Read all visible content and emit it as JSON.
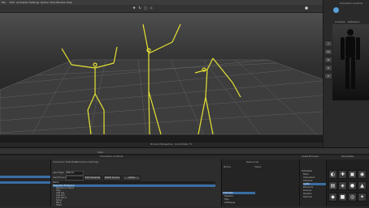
{
  "menubar": {
    "items": [
      "File",
      "Edit",
      "Animation",
      "Settings",
      "Python Tools",
      "Window",
      "Help"
    ]
  },
  "toolbar": {
    "icons": [
      "move-icon",
      "rotate-icon",
      "scale-icon",
      "select-icon",
      "camera-icon"
    ]
  },
  "viewport": {
    "status_text": "Producer Perspective · Current take: T1"
  },
  "navigator": {
    "title": "Character Controls",
    "tabs": [
      "Controls",
      "Definition"
    ],
    "side_buttons": [
      "T",
      "FK",
      "IK",
      "R",
      "P"
    ]
  },
  "timeline": {
    "title": "Keys"
  },
  "filters": {
    "title": "Character Controls",
    "tabs": [
      "Character Definition",
      "Character Settings"
    ],
    "fields": [
      {
        "label": "Input Type",
        "value": "Stance"
      },
      {
        "label": "Input Source",
        "value": ""
      }
    ],
    "buttons": [
      "Edit Character",
      "Match Source",
      "Active"
    ],
    "list_header": "Name",
    "list_items": [
      "Character Extension",
      "Reference Object",
      "Hips",
      "Left Leg",
      "Left Arm",
      "Left Hand",
      "Spine",
      "Neck",
      "Head"
    ]
  },
  "resources": {
    "title": "Resources",
    "tabs": [
      "Name",
      "Value"
    ],
    "items": [
      "Character",
      "Skeleton",
      "Hips",
      "LeftUpLeg",
      "RightUpLeg",
      "Spine"
    ]
  },
  "tree": {
    "title": "Asset Browser",
    "items": [
      "Templates",
      "Basic",
      "Characters",
      "Cameras",
      "Lights",
      "Elements",
      "Devices",
      "Shaders",
      "Textures"
    ]
  },
  "tools": {
    "title": "Templates",
    "tiles": [
      "◐",
      "✚",
      "▣",
      "◉",
      "▤",
      "◈",
      "●",
      "▲",
      "◆",
      "■",
      "◎",
      "✦"
    ]
  }
}
